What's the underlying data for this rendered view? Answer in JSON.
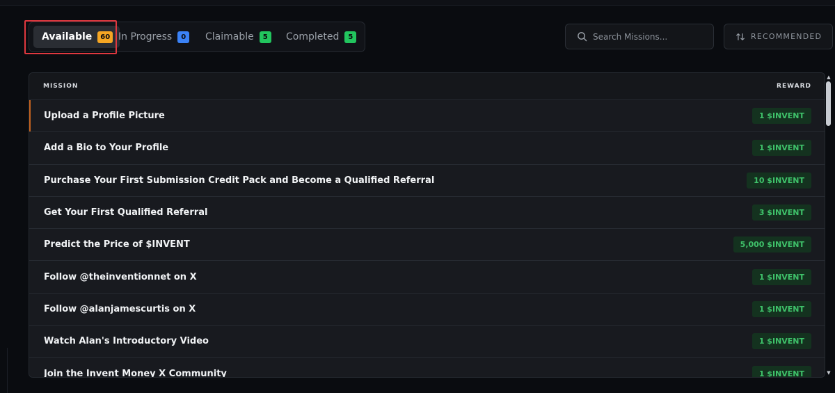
{
  "tabs": [
    {
      "label": "Available",
      "count": "60",
      "badge_color": "#f5a623",
      "active": true
    },
    {
      "label": "In Progress",
      "count": "0",
      "badge_color": "#3b82f6",
      "active": false
    },
    {
      "label": "Claimable",
      "count": "5",
      "badge_color": "#22c55e",
      "active": false
    },
    {
      "label": "Completed",
      "count": "5",
      "badge_color": "#22c55e",
      "active": false
    }
  ],
  "search": {
    "placeholder": "Search Missions..."
  },
  "sort": {
    "label": "RECOMMENDED",
    "icon": "sort-arrows-icon"
  },
  "table": {
    "headers": {
      "mission": "MISSION",
      "reward": "REWARD"
    },
    "rows": [
      {
        "title": "Upload a Profile Picture",
        "reward": "1 $INVENT"
      },
      {
        "title": "Add a Bio to Your Profile",
        "reward": "1 $INVENT"
      },
      {
        "title": "Purchase Your First Submission Credit Pack and Become a Qualified Referral",
        "reward": "10 $INVENT"
      },
      {
        "title": "Get Your First Qualified Referral",
        "reward": "3 $INVENT"
      },
      {
        "title": "Predict the Price of $INVENT",
        "reward": "5,000 $INVENT"
      },
      {
        "title": "Follow @theinventionnet on X",
        "reward": "1 $INVENT"
      },
      {
        "title": "Follow @alanjamescurtis on X",
        "reward": "1 $INVENT"
      },
      {
        "title": "Watch Alan's Introductory Video",
        "reward": "1 $INVENT"
      },
      {
        "title": "Join the Invent Money X Community",
        "reward": "1 $INVENT"
      }
    ]
  },
  "colors": {
    "accent_selected_row": "#c5631f",
    "highlight_box": "#e0383f",
    "reward_text": "#3fc26a",
    "reward_bg": "#14321f"
  }
}
